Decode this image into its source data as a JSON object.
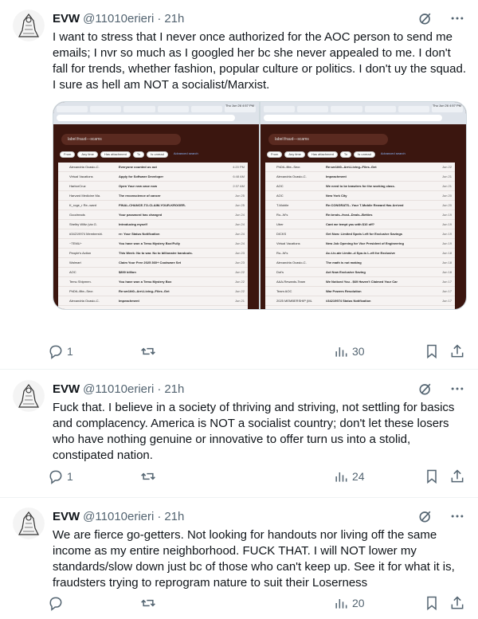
{
  "tweets": [
    {
      "name": "EVW",
      "handle": "@11010erieri",
      "time": "21h",
      "text": "I want to stress that I never once authorized for the AOC person to send me emails; I nvr so much as I googled her bc she never appealed to me. I don't fall for trends, whether fashion, popular culture or politics. I don't uy the squad. I sure as hell am NOT a socialist/Marxist.",
      "replies": "1",
      "retweets": "",
      "views": "30"
    },
    {
      "name": "EVW",
      "handle": "@11010erieri",
      "time": "21h",
      "text": "Fuck that. I believe in a society of thriving and striving, not settling for basics and complacency. America is NOT a socialist country; don't let these losers who have nothing genuine or innovative to offer turn us into a stolid, constipated nation.",
      "replies": "1",
      "retweets": "",
      "views": "24"
    },
    {
      "name": "EVW",
      "handle": "@11010erieri",
      "time": "21h",
      "text": "We are fierce go-getters. Not looking for handouts nor living off the same income as my entire neighborhood. FUCK THAT. I will NOT lower my standards/slow down just bc of those who can't keep up. See it for what it is, fraudsters trying to reprogram nature to suit their Loserness",
      "replies": "",
      "retweets": "",
      "views": "20"
    }
  ],
  "screenshots": [
    {
      "clock": "Thu Jun 26 4:57 PM",
      "search": "label:fraud---scams",
      "filters": [
        "From",
        "Any time",
        "Has attachment",
        "To",
        "Is unread",
        "Advanced search"
      ],
      "rows": [
        {
          "from": "Alexandria Ocasio-C.",
          "subject": "Everyone counted us out",
          "date": "4:20 PM"
        },
        {
          "from": "Virtual Vacations",
          "subject": "Apply for Software Developer",
          "date": "6:48 AM"
        },
        {
          "from": "HarborCruz",
          "subject": "Open Your new case now",
          "date": "2:37 AM"
        },
        {
          "from": "Harvard Medicine Ma.",
          "subject": "The reconscience of cancer",
          "date": "Jun 25"
        },
        {
          "from": "K_roge_r Re--ward",
          "subject": "FINAL-CHANCE-TO-CLAIM-YOUR-KROGER-",
          "date": "Jun 25"
        },
        {
          "from": "Goodreads",
          "subject": "Your password has changed",
          "date": "Jun 24"
        },
        {
          "from": "Shelby Wiltz (via G.",
          "subject": "Introducing myself",
          "date": "Jun 24"
        },
        {
          "from": "#34219974 Membershi.",
          "subject": "re: Your Status Notification",
          "date": "Jun 24"
        },
        {
          "from": "~TEMU~",
          "subject": "You have won a Temu Mystery Box!Fully",
          "date": "Jun 24"
        },
        {
          "from": "People's Action",
          "subject": "This Week: No to war. No to billionaire handouts.",
          "date": "Jun 23"
        },
        {
          "from": "Walmart",
          "subject": "Claim Your Free 2025 360+ Cookware Set",
          "date": "Jun 23"
        },
        {
          "from": "AOC",
          "subject": "$800 billion",
          "date": "Jun 22"
        },
        {
          "from": "Temu Shipmen.",
          "subject": "You have won a Temu Mystery Box",
          "date": "Jun 22"
        },
        {
          "from": "PhDtl--flite--Secr.",
          "subject": "Re:we1iti0--Arrt-Living--Files..Get",
          "date": "Jun 22"
        },
        {
          "from": "Alexandria Ocasio-C.",
          "subject": "Impeachment",
          "date": "Jun 21"
        },
        {
          "from": "AOC",
          "subject": "We need to be brawlers for the working class.",
          "date": "Jun 21"
        }
      ]
    },
    {
      "clock": "Thu Jun 26 4:57 PM",
      "search": "label:fraud---scams",
      "filters": [
        "From",
        "Any time",
        "Has attachment",
        "To",
        "Is unread",
        "Advanced search"
      ],
      "rows": [
        {
          "from": "PhDtl--flite--Secr.",
          "subject": "Re:we1iti0--Arrt-Living--Files..Get",
          "date": "Jun 22"
        },
        {
          "from": "Alexandria Ocasio-C.",
          "subject": "Impeachment",
          "date": "Jun 21"
        },
        {
          "from": "AOC",
          "subject": "We need to be brawlers for the working class.",
          "date": "Jun 21"
        },
        {
          "from": "AOC",
          "subject": "New York City",
          "date": "Jun 20"
        },
        {
          "from": "T-Mobile",
          "subject": "Re:CONGRATS...Your T-Mobile Reward Has Arrived",
          "date": "Jun 20"
        },
        {
          "from": "Ro--W's",
          "subject": "Re:brnds--frost--Deals--Betties",
          "date": "Jun 19"
        },
        {
          "from": "Uber",
          "subject": "Cant we tempt you with $10 off?",
          "date": "Jun 19"
        },
        {
          "from": "DICKS",
          "subject": "Get Now: Limited Spots Left for Exclusive Savings",
          "date": "Jun 19"
        },
        {
          "from": "Virtual Vacations",
          "subject": "New Job Opening for Vice President of Engineering",
          "date": "Jun 19"
        },
        {
          "from": "Ro--W's",
          "subject": "Ac-t-iv-ate Limite--d Spo-ts L-eft for Exclusive",
          "date": "Jun 18"
        },
        {
          "from": "Alexandria Ocasio-C.",
          "subject": "The math is not making",
          "date": "Jun 18"
        },
        {
          "from": "Dot's",
          "subject": "Act Now Exclusive Saving",
          "date": "Jun 18"
        },
        {
          "from": "AAA-Rewards-Team",
          "subject": "We Noticed You - $69 Haven't Claimed Your Car",
          "date": "Jun 17"
        },
        {
          "from": "Team AOC",
          "subject": "War Powers Resolution",
          "date": "Jun 17"
        },
        {
          "from": "2025 MEMBERSHIP (ML",
          "subject": "#34219974 Status Notification",
          "date": "Jun 17"
        },
        {
          "from": "Alexandria Ocasio-C.",
          "subject": "ICE just arrested Brad Lander",
          "date": "Jun 17"
        },
        {
          "from": "Temu Shipment",
          "subject": "You Have Won a Temu Mystery Box",
          "date": "Jun 16"
        }
      ]
    }
  ]
}
